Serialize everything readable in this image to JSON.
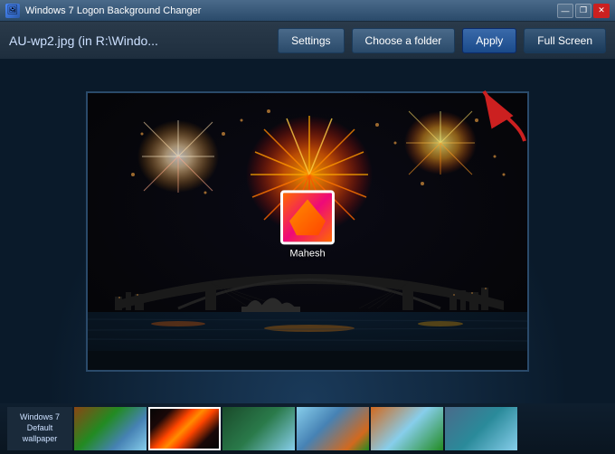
{
  "titleBar": {
    "title": "Windows 7 Logon Background Changer",
    "icon": "🖼",
    "controls": {
      "minimize": "—",
      "restore": "❐",
      "close": "✕"
    }
  },
  "toolbar": {
    "filename": "AU-wp2.jpg (in R:\\Windo...",
    "buttons": {
      "settings": "Settings",
      "chooseFolder": "Choose a folder",
      "apply": "Apply",
      "fullScreen": "Full Screen"
    }
  },
  "preview": {
    "userName": "Mahesh"
  },
  "thumbnails": {
    "label": "Windows 7 Default wallpaper",
    "items": [
      {
        "id": 1,
        "label": "Windows 7\nDefault\nwallpaper",
        "selected": false,
        "type": "label"
      },
      {
        "id": 2,
        "label": "",
        "selected": false,
        "type": "img",
        "bgClass": "thumb-bg-1"
      },
      {
        "id": 3,
        "label": "",
        "selected": true,
        "type": "img",
        "bgClass": "thumb-bg-2"
      },
      {
        "id": 4,
        "label": "",
        "selected": false,
        "type": "img",
        "bgClass": "thumb-bg-3"
      },
      {
        "id": 5,
        "label": "",
        "selected": false,
        "type": "img",
        "bgClass": "thumb-bg-4"
      },
      {
        "id": 6,
        "label": "",
        "selected": false,
        "type": "img",
        "bgClass": "thumb-bg-5"
      },
      {
        "id": 7,
        "label": "",
        "selected": false,
        "type": "img",
        "bgClass": "thumb-bg-6"
      }
    ]
  }
}
